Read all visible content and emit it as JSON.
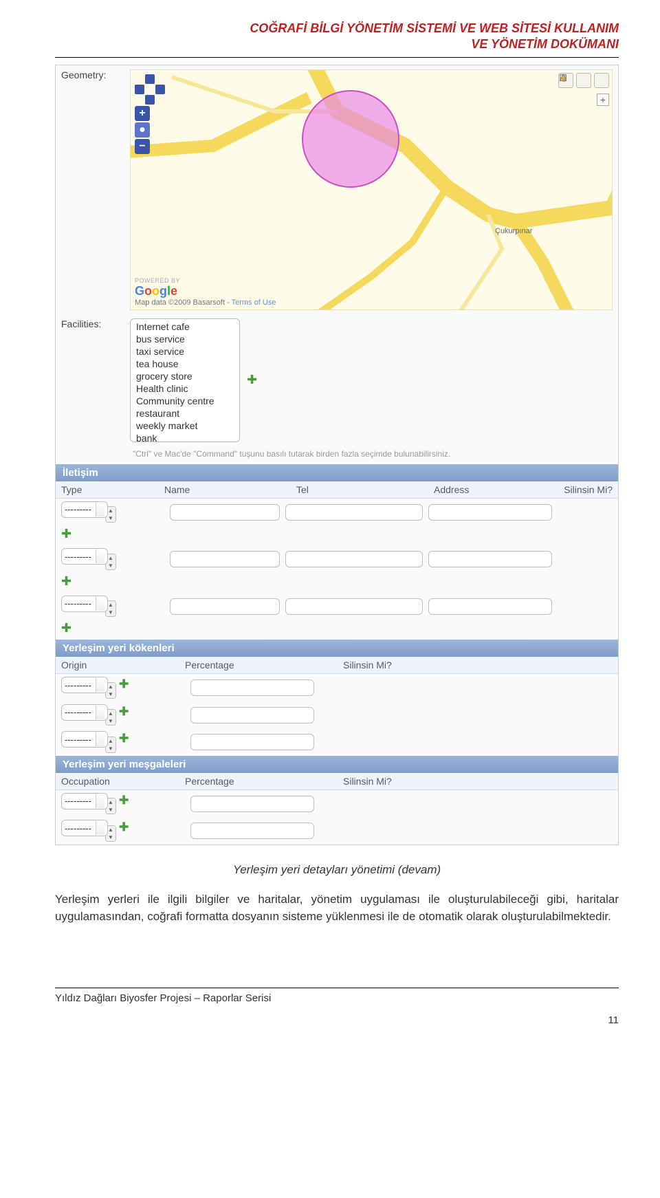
{
  "header": {
    "line1": "COĞRAFİ BİLGİ YÖNETİM SİSTEMİ VE WEB SİTESİ KULLANIM",
    "line2": "VE YÖNETİM DOKÜMANI"
  },
  "geometry": {
    "label": "Geometry:",
    "place_label": "Çukurpınar",
    "powered": "POWERED BY",
    "attribution": "Map data ©2009 Basarsoft - ",
    "terms": "Terms of Use"
  },
  "facilities": {
    "label": "Facilities:",
    "options": [
      "Internet cafe",
      "bus service",
      "taxi service",
      "tea house",
      "grocery store",
      "Health clinic",
      "Community centre",
      "restaurant",
      "weekly market",
      "bank"
    ],
    "hint": "\"Ctrl\" ve Mac'de \"Command\" tuşunu basılı tutarak birden fazla seçimde bulunabilirsiniz."
  },
  "iletisim": {
    "title": "İletişim",
    "cols": {
      "type": "Type",
      "name": "Name",
      "tel": "Tel",
      "address": "Address",
      "delete": "Silinsin Mi?"
    },
    "placeholder": "---------"
  },
  "kokenleri": {
    "title": "Yerleşim yeri kökenleri",
    "cols": {
      "origin": "Origin",
      "percentage": "Percentage",
      "delete": "Silinsin Mi?"
    },
    "placeholder": "---------"
  },
  "mesgaleleri": {
    "title": "Yerleşim yeri meşgaleleri",
    "cols": {
      "occupation": "Occupation",
      "percentage": "Percentage",
      "delete": "Silinsin Mi?"
    },
    "placeholder": "---------"
  },
  "caption": "Yerleşim yeri detayları yönetimi (devam)",
  "paragraph": "Yerleşim yerleri ile ilgili bilgiler ve haritalar, yönetim uygulaması ile oluşturulabileceği gibi, haritalar uygulamasından, coğrafi formatta dosyanın sisteme yüklenmesi ile de otomatik olarak oluşturulabilmektedir.",
  "footer": {
    "text": "Yıldız Dağları Biyosfer Projesi – Raporlar Serisi",
    "page": "11"
  }
}
